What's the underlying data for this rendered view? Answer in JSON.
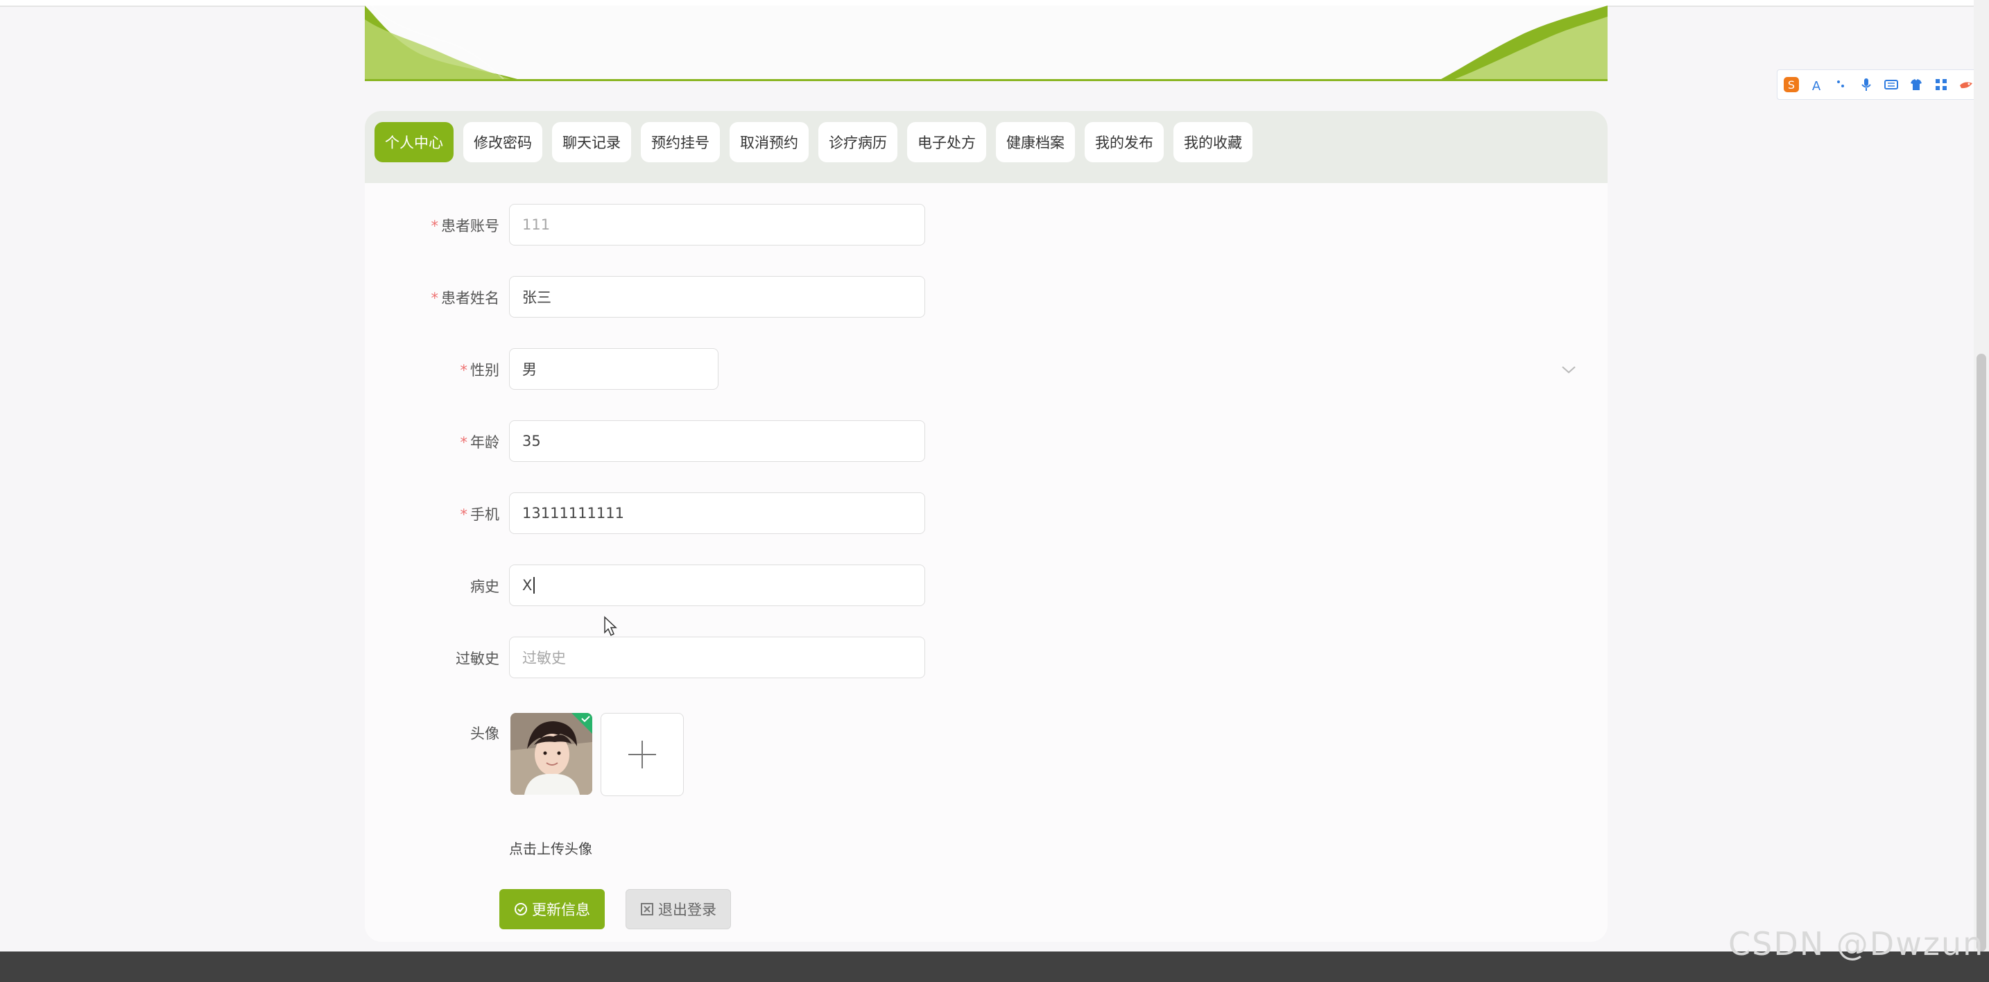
{
  "tabs": [
    "个人中心",
    "修改密码",
    "聊天记录",
    "预约挂号",
    "取消预约",
    "诊疗病历",
    "电子处方",
    "健康档案",
    "我的发布",
    "我的收藏"
  ],
  "form": {
    "account": {
      "label": "患者账号",
      "value": "111"
    },
    "name": {
      "label": "患者姓名",
      "value": "张三"
    },
    "gender": {
      "label": "性别",
      "value": "男"
    },
    "age": {
      "label": "年龄",
      "value": "35"
    },
    "phone": {
      "label": "手机",
      "value": "13111111111"
    },
    "history": {
      "label": "病史",
      "value": "X"
    },
    "allergy": {
      "label": "过敏史",
      "placeholder": "过敏史"
    },
    "avatar": {
      "label": "头像",
      "hint": "点击上传头像"
    }
  },
  "buttons": {
    "update": "更新信息",
    "logout": "退出登录"
  },
  "watermark": "CSDN @Dwzun",
  "colors": {
    "accent": "#85b21a",
    "banner_line": "#8ab522"
  }
}
